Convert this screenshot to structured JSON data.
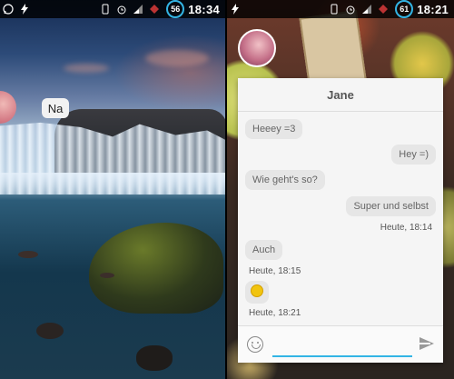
{
  "left_status": {
    "battery": "56",
    "time": "18:34",
    "icons": [
      "whatsapp-icon",
      "bolt-icon",
      "vibrate-icon",
      "alarm-icon",
      "signal-icon",
      "data-icon",
      "battery-ring-icon"
    ]
  },
  "right_status": {
    "battery": "61",
    "time": "18:21",
    "icons": [
      "bolt-icon",
      "vibrate-icon",
      "alarm-icon",
      "signal-icon",
      "data-icon",
      "battery-ring-icon"
    ]
  },
  "left_screen": {
    "chat_head_bubble": "Na"
  },
  "chat": {
    "title": "Jane",
    "messages": [
      {
        "text": "Heeey =3",
        "side": "incoming"
      },
      {
        "text": "Hey =)",
        "side": "outgoing"
      },
      {
        "text": "Wie geht's so?",
        "side": "incoming"
      },
      {
        "text": "Super und selbst",
        "side": "outgoing"
      },
      {
        "text": "Heute, 18:14",
        "side": "timestamp-right"
      },
      {
        "text": "Auch",
        "side": "incoming"
      },
      {
        "text": "Heute, 18:15",
        "side": "timestamp-left"
      },
      {
        "text": "",
        "side": "incoming-emoji"
      },
      {
        "text": "Heute, 18:21",
        "side": "timestamp-left"
      }
    ],
    "input_value": ""
  },
  "colors": {
    "accent": "#33b5e5",
    "bubble": "#e6e6e6",
    "chat_bg": "#f5f5f5"
  }
}
